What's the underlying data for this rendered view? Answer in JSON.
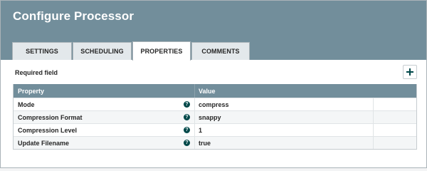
{
  "dialog": {
    "title": "Configure Processor"
  },
  "tabs": [
    {
      "label": "SETTINGS"
    },
    {
      "label": "SCHEDULING"
    },
    {
      "label": "PROPERTIES",
      "active": true
    },
    {
      "label": "COMMENTS"
    }
  ],
  "properties": {
    "required_label": "Required field",
    "add_icon": "plus-icon",
    "help_icon": "question-circle-icon",
    "columns": {
      "property": "Property",
      "value": "Value"
    },
    "rows": [
      {
        "name": "Mode",
        "value": "compress"
      },
      {
        "name": "Compression Format",
        "value": "snappy"
      },
      {
        "name": "Compression Level",
        "value": "1"
      },
      {
        "name": "Update Filename",
        "value": "true"
      }
    ]
  },
  "colors": {
    "header": "#728e9b",
    "help_icon": "#004849",
    "tab_inactive": "#e3e8eb"
  }
}
